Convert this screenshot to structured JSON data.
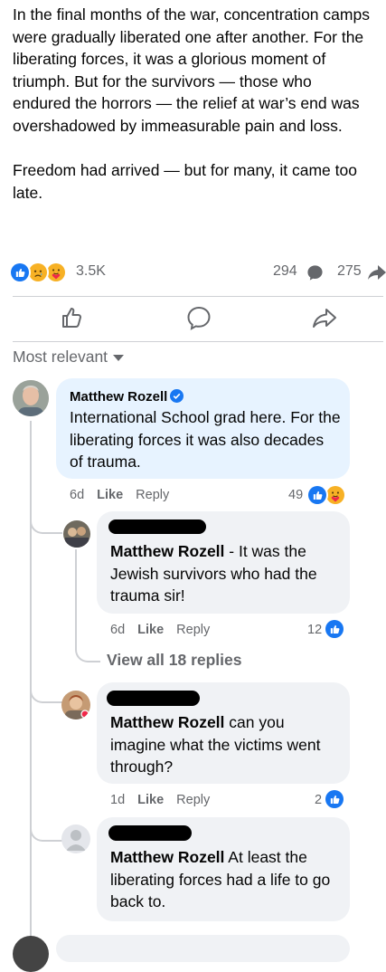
{
  "post": {
    "paragraphs": [
      "In the final months of the war, concentration camps were gradually liberated one after another. For the liberating forces, it was a glorious moment of triumph. But for the survivors — those who endured the horrors — the relief at war’s end was overshadowed by immeasurable pain and loss.",
      "Freedom had arrived — but for many, it came too late."
    ]
  },
  "stats": {
    "reactions_count": "3.5K",
    "comments_count": "294",
    "shares_count": "275"
  },
  "sort": {
    "label": "Most relevant"
  },
  "comments": [
    {
      "author": "Matthew Rozell",
      "verified": true,
      "text": "International School grad here. For the liberating forces it was also decades of trauma.",
      "time": "6d",
      "like": "Like",
      "reply": "Reply",
      "reaction_count": "49"
    }
  ],
  "replies": [
    {
      "mention": "Matthew Rozell",
      "text": " - It was the Jewish survivors who had the trauma sir!",
      "time": "6d",
      "like": "Like",
      "reply": "Reply",
      "reaction_count": "12"
    }
  ],
  "view_replies": "View all 18 replies",
  "replies2": [
    {
      "mention": "Matthew Rozell",
      "text": " can you imagine what the victims went through?",
      "time": "1d",
      "like": "Like",
      "reply": "Reply",
      "reaction_count": "2"
    },
    {
      "mention": "Matthew Rozell",
      "text": " At least the liberating forces had a life to go back to."
    }
  ],
  "colors": {
    "like_blue": "#1877f2",
    "muted": "#65676b",
    "bubble": "#f0f2f5",
    "bubble_highlight": "#e7f3ff"
  }
}
